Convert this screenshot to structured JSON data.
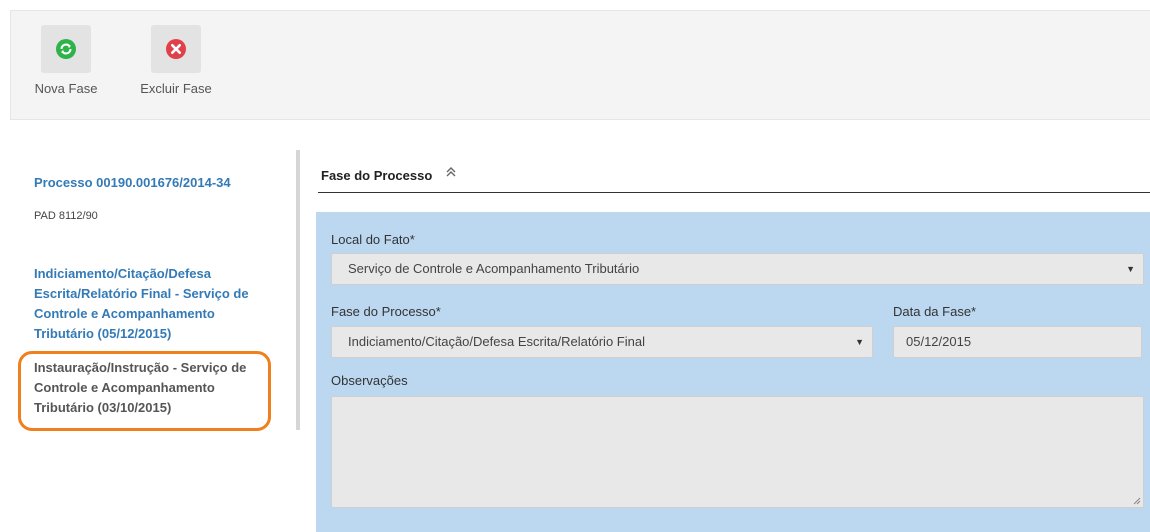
{
  "toolbar": {
    "nova_fase_label": "Nova Fase",
    "excluir_fase_label": "Excluir Fase",
    "nova_fase_icon": "refresh-icon",
    "excluir_fase_icon": "close-circle-icon",
    "nova_fase_color": "#2eb34a",
    "excluir_fase_color": "#e0404a"
  },
  "sidebar": {
    "process_title": "Processo 00190.001676/2014-34",
    "process_subtitle": "PAD 8112/90",
    "phases": [
      {
        "label": "Indiciamento/Citação/Defesa Escrita/Relatório Final - Serviço de Controle e Acompanhamento Tributário (05/12/2015)"
      },
      {
        "label": "Instauração/Instrução - Serviço de Controle e Acompanhamento Tributário (03/10/2015)",
        "highlighted": true
      }
    ],
    "highlight_color": "#f07f1e"
  },
  "main": {
    "section_title": "Fase do Processo",
    "section_toggle_icon": "chevron-double-up-icon",
    "form": {
      "local_label": "Local do Fato*",
      "local_value": "Serviço de Controle e Acompanhamento Tributário",
      "fase_label": "Fase do Processo*",
      "fase_value": "Indiciamento/Citação/Defesa Escrita/Relatório Final",
      "data_label": "Data da Fase*",
      "data_value": "05/12/2015",
      "obs_label": "Observações",
      "obs_value": ""
    },
    "panel_color": "#bcd8f0"
  }
}
